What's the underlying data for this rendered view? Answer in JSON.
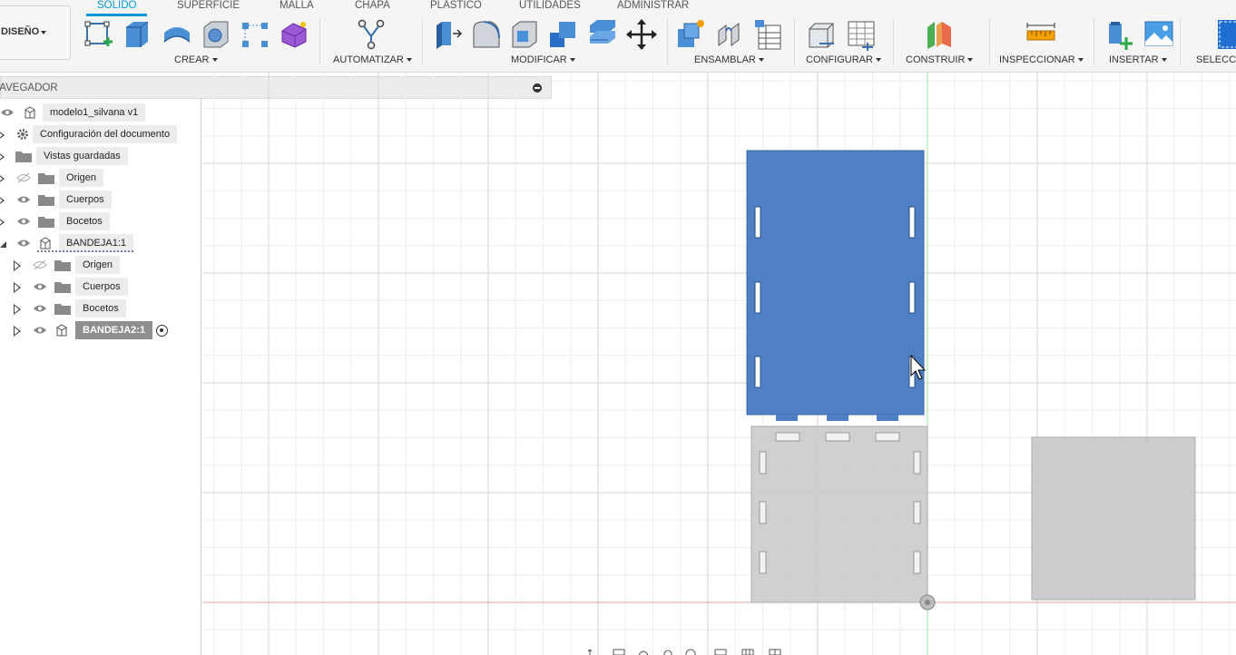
{
  "toolbar": {
    "workspace_label": "DISEÑO",
    "tabs": [
      "SÓLIDO",
      "SUPERFICIE",
      "MALLA",
      "CHAPA",
      "PLÁSTICO",
      "UTILIDADES",
      "ADMINISTRAR"
    ],
    "active_tab": "SÓLIDO",
    "groups": [
      "CREAR",
      "AUTOMATIZAR",
      "MODIFICAR",
      "ENSAMBLAR",
      "CONFIGURAR",
      "CONSTRUIR",
      "INSPECCIONAR",
      "INSERTAR",
      "SELECC"
    ],
    "accent_color": "#0696d7"
  },
  "navigator": {
    "title": "NAVEGADOR",
    "items": [
      {
        "label": "modelo1_silvana v1",
        "icon": "component-icon",
        "expand": "none",
        "visibility": "visible"
      },
      {
        "label": "Configuración del documento",
        "icon": "gear-icon",
        "expand": "collapsed",
        "visibility": "none"
      },
      {
        "label": "Vistas guardadas",
        "icon": "folder-icon",
        "expand": "collapsed",
        "visibility": "none"
      },
      {
        "label": "Origen",
        "icon": "folder-icon",
        "expand": "collapsed",
        "visibility": "hidden"
      },
      {
        "label": "Cuerpos",
        "icon": "folder-icon",
        "expand": "collapsed",
        "visibility": "visible"
      },
      {
        "label": "Bocetos",
        "icon": "folder-icon",
        "expand": "collapsed",
        "visibility": "visible"
      },
      {
        "label": "BANDEJA1:1",
        "icon": "component-icon",
        "expand": "expanded",
        "visibility": "visible"
      },
      {
        "label": "Origen",
        "icon": "folder-icon",
        "expand": "collapsed",
        "visibility": "hidden"
      },
      {
        "label": "Cuerpos",
        "icon": "folder-icon",
        "expand": "collapsed",
        "visibility": "visible"
      },
      {
        "label": "Bocetos",
        "icon": "folder-icon",
        "expand": "collapsed",
        "visibility": "visible"
      },
      {
        "label": "BANDEJA2:1",
        "icon": "component-icon",
        "expand": "collapsed",
        "visibility": "visible",
        "selected": true,
        "activation_target": true
      }
    ]
  },
  "canvas": {
    "background": "#ffffff",
    "selected_body_color": "#5080c4",
    "ghost_body_color": "#c8c8c8",
    "x_axis_color": "#e8a09a",
    "y_axis_color": "#9be89b"
  }
}
